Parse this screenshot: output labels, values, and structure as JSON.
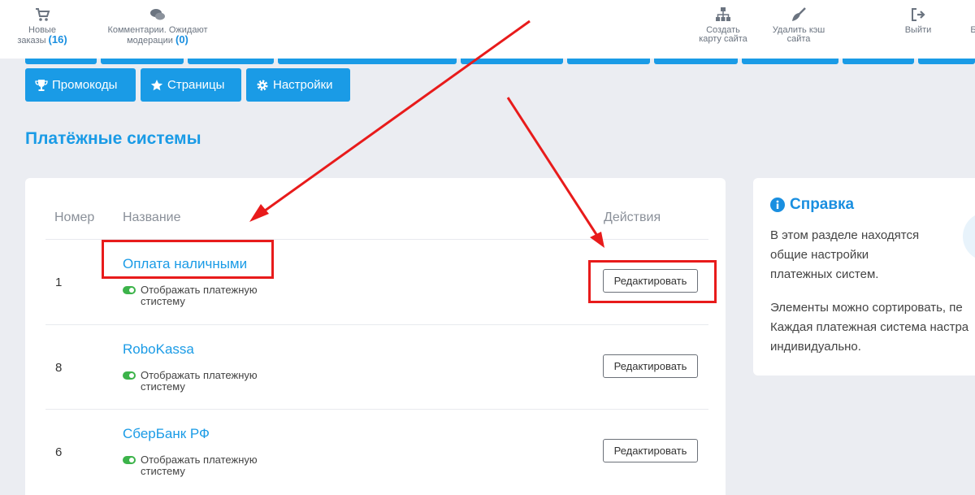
{
  "topbar": {
    "new_orders_label": "Новые",
    "new_orders_label2": "заказы",
    "new_orders_count": "(16)",
    "comments_label": "Комментарии. Ожидают",
    "comments_label2": "модерации",
    "comments_count": "(0)",
    "sitemap_label": "Создать",
    "sitemap_label2": "карту сайта",
    "cache_label": "Удалить кэш",
    "cache_label2": "сайта",
    "logout_label": "Выйти",
    "cut_label": "Б"
  },
  "nav_buttons": {
    "promo": "Промокоды",
    "pages": "Страницы",
    "settings": "Настройки"
  },
  "page_title": "Платёжные системы",
  "table": {
    "col_number": "Номер",
    "col_name": "Название",
    "col_actions": "Действия",
    "rows": [
      {
        "number": "1",
        "name": "Оплата наличными",
        "status_1": "Отображать платежную",
        "status_2": "стистему",
        "edit": "Редактировать"
      },
      {
        "number": "8",
        "name": "RoboKassa",
        "status_1": "Отображать платежную",
        "status_2": "стистему",
        "edit": "Редактировать"
      },
      {
        "number": "6",
        "name": "СберБанк РФ",
        "status_1": "Отображать платежную",
        "status_2": "стистему",
        "edit": "Редактировать"
      }
    ]
  },
  "help": {
    "title": "Справка",
    "p1_l1": "В этом разделе находятся",
    "p1_l2": "общие настройки",
    "p1_l3": "платежных систем.",
    "p2_l1": "Элементы можно сортировать, пе",
    "p2_l2": "Каждая платежная система настра",
    "p2_l3": "индивидуально."
  },
  "colors": {
    "accent": "#1a9be6",
    "annotation": "#e81b1b",
    "toggle_on": "#3cb34a"
  }
}
